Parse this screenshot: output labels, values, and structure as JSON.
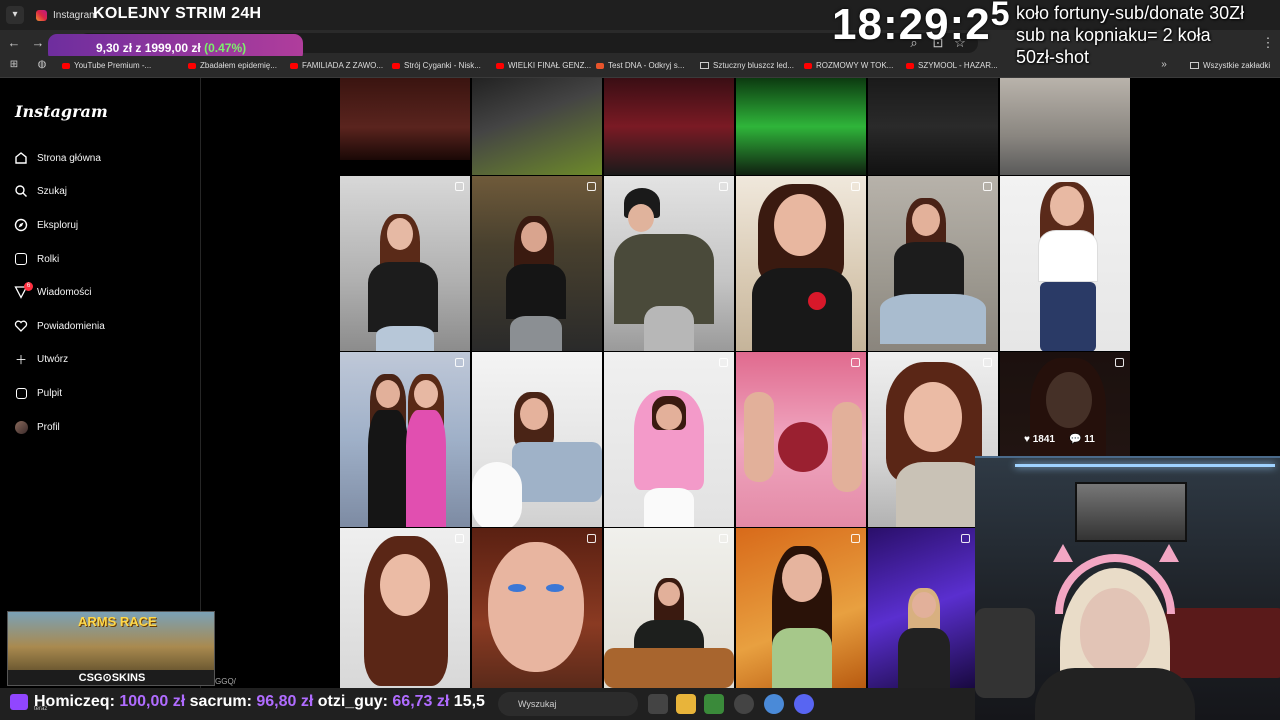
{
  "browser": {
    "tab_title": "Instagram",
    "stream_title": "KOLEJNY STRIM 24H",
    "bookmarks": [
      "YouTube Premium -...",
      "Zbadałem epidemię...",
      "FAMILIADA Z ZAWO...",
      "Strój Cyganki - Nisk...",
      "WIELKI FINAŁ GENZ...",
      "Test DNA - Odkryj s...",
      "Sztuczny bluszcz led...",
      "ROZMOWY W TOK...",
      "SZYMOOL - HAZAR...",
      "Wszystkie zakładki"
    ]
  },
  "overlay": {
    "donate_text": "9,30 zł z 1999,00 zł",
    "donate_pct": "(0.47%)",
    "clock": "18:29:2",
    "clock_tail": "5",
    "wheel_lines": [
      "koło fortuny-sub/donate 30Zł",
      "sub na kopniaku= 2 koła",
      "50zł-shot"
    ]
  },
  "sidebar": {
    "logo": "Instagram",
    "items": [
      {
        "label": "Strona główna",
        "icon": "home-icon"
      },
      {
        "label": "Szukaj",
        "icon": "search-icon"
      },
      {
        "label": "Eksploruj",
        "icon": "compass-icon"
      },
      {
        "label": "Rolki",
        "icon": "reels-icon"
      },
      {
        "label": "Wiadomości",
        "icon": "messages-icon",
        "badge": "6"
      },
      {
        "label": "Powiadomienia",
        "icon": "heart-icon"
      },
      {
        "label": "Utwórz",
        "icon": "plus-icon"
      },
      {
        "label": "Pulpit",
        "icon": "dashboard-icon"
      },
      {
        "label": "Profil",
        "icon": "avatar"
      }
    ]
  },
  "grid": {
    "hover_likes": "1841",
    "hover_comments": "11"
  },
  "csgo": {
    "title": "ARMS RACE",
    "brand": "CSG⊙SKINS",
    "url_fragment": "GGQ/"
  },
  "ticker": {
    "entries": [
      {
        "name": "Homiczeq:",
        "amount": "100,00 zł"
      },
      {
        "name": "sacrum:",
        "amount": "96,80 zł"
      },
      {
        "name": "otzi_guy:",
        "amount": "66,73 zł"
      }
    ],
    "tail": "15,5",
    "teraz": "teraz"
  },
  "taskbar": {
    "search_placeholder": "Wyszukaj"
  },
  "colors": {
    "accent_purple": "#9146ff",
    "donate_green": "#7cf06b",
    "ig_badge": "#ff3040"
  }
}
